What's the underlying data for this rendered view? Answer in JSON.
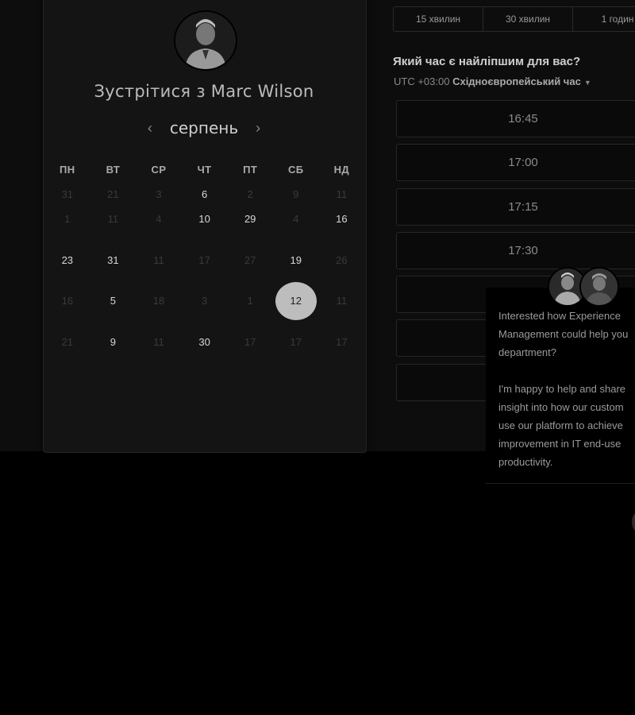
{
  "host": {
    "title": "Зустрітися з Marc Wilson"
  },
  "calendar": {
    "month": "серпень",
    "prev_icon": "chevron-left-icon",
    "next_icon": "chevron-right-icon",
    "weekdays": [
      "ПН",
      "ВТ",
      "СР",
      "ЧТ",
      "ПТ",
      "СБ",
      "НД"
    ],
    "weeks": [
      [
        {
          "d": "31",
          "on": false
        },
        {
          "d": "21",
          "on": false
        },
        {
          "d": "3",
          "on": false
        },
        {
          "d": "6",
          "on": true
        },
        {
          "d": "2",
          "on": false
        },
        {
          "d": "9",
          "on": false
        },
        {
          "d": "11",
          "on": false
        }
      ],
      [
        {
          "d": "1",
          "on": false
        },
        {
          "d": "11",
          "on": false
        },
        {
          "d": "4",
          "on": false
        },
        {
          "d": "10",
          "on": true
        },
        {
          "d": "29",
          "on": true
        },
        {
          "d": "4",
          "on": false
        },
        {
          "d": "16",
          "on": true
        }
      ],
      [
        {
          "d": "23",
          "on": true
        },
        {
          "d": "31",
          "on": true
        },
        {
          "d": "11",
          "on": false
        },
        {
          "d": "17",
          "on": false
        },
        {
          "d": "27",
          "on": false
        },
        {
          "d": "19",
          "on": true
        },
        {
          "d": "26",
          "on": false
        }
      ],
      [
        {
          "d": "16",
          "on": false
        },
        {
          "d": "5",
          "on": true
        },
        {
          "d": "18",
          "on": false
        },
        {
          "d": "3",
          "on": false
        },
        {
          "d": "1",
          "on": false
        },
        {
          "d": "12",
          "on": true,
          "sel": true
        },
        {
          "d": "11",
          "on": false
        }
      ],
      [
        {
          "d": "21",
          "on": false
        },
        {
          "d": "9",
          "on": true
        },
        {
          "d": "11",
          "on": false
        },
        {
          "d": "30",
          "on": true
        },
        {
          "d": "17",
          "on": false
        },
        {
          "d": "17",
          "on": false
        },
        {
          "d": "17",
          "on": false
        }
      ]
    ]
  },
  "durations": [
    "15 хвилин",
    "30 хвилин",
    "1 годин"
  ],
  "schedule": {
    "question": "Який час є найліпшим для вас?",
    "tz_offset": "UTC +03:00",
    "tz_name": "Східноєвропейський час",
    "slots": [
      "16:45",
      "17:00",
      "17:15",
      "17:30",
      "",
      "",
      ""
    ]
  },
  "chat": {
    "message": "Interested how Experience\nManagement could help you\ndepartment?\n\nI'm happy to help and share\ninsight into how our custom\nuse our platform to achieve\nimprovement in IT end-use\nproductivity."
  }
}
